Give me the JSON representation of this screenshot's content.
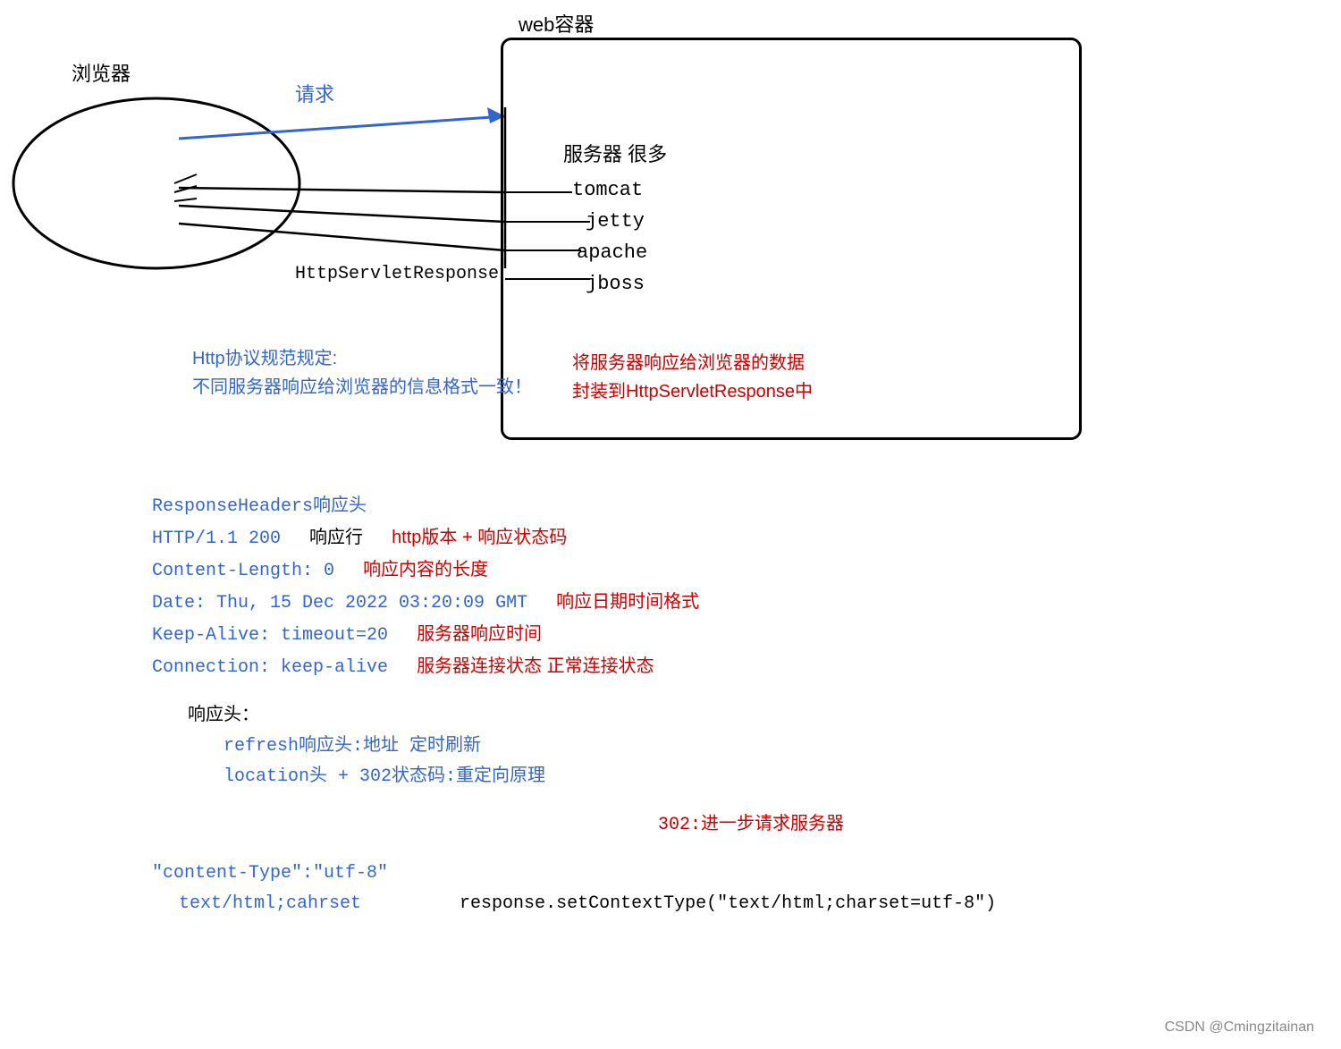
{
  "diagram": {
    "web_container_label": "web容器",
    "browser_label": "浏览器",
    "request_label": "请求",
    "server_label": "服务器 很多",
    "server_items": [
      "tomcat",
      "jetty",
      "apache",
      "jboss"
    ],
    "http_servlet_response": "HttpServletResponse",
    "http_protocol_line1": "Http协议规范规定:",
    "http_protocol_line2": "不同服务器响应给浏览器的信息格式一致！",
    "server_response_line1": "将服务器响应给浏览器的数据",
    "server_response_line2": "封装到HttpServletResponse中"
  },
  "response_headers": {
    "title": "ResponseHeaders响应头",
    "http_line": "HTTP/1.1 200",
    "http_comment_label": "响应行",
    "http_comment": "http版本 + 响应状态码",
    "content_length_line": "Content-Length: 0",
    "content_length_comment": "响应内容的长度",
    "date_line": "Date: Thu, 15 Dec 2022 03:20:09 GMT",
    "date_comment": "响应日期时间格式",
    "keep_alive_line": "Keep-Alive: timeout=20",
    "keep_alive_comment": "服务器响应时间",
    "connection_line": "Connection: keep-alive",
    "connection_comment": "服务器连接状态 正常连接状态"
  },
  "response_head": {
    "title": "响应头：",
    "refresh_line": "refresh响应头:地址   定时刷新",
    "location_line": "location头 + 302状态码:重定向原理",
    "code_302": "302:进一步请求服务器"
  },
  "content_type": {
    "line1": "\"content-Type\":\"utf-8\"",
    "line2": "text/html;cahrset",
    "comment": "response.setContextType(\"text/html;charset=utf-8\")"
  },
  "footer": {
    "text": "CSDN @Cmingzitainan"
  }
}
